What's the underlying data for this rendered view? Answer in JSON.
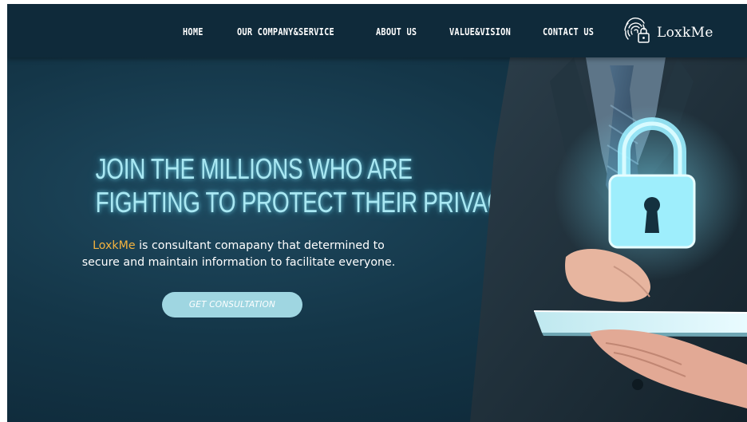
{
  "nav": {
    "items": [
      {
        "label": "HOME"
      },
      {
        "label": "OUR COMPANY&SERVICE"
      },
      {
        "label": "ABOUT US"
      },
      {
        "label": "VALUE&VISION"
      },
      {
        "label": "CONTACT US"
      }
    ],
    "logo_text": "LoxkMe"
  },
  "hero": {
    "title_line1": "JOIN THE MILLIONS WHO ARE",
    "title_line2": "FIGHTING TO PROTECT THEIR PRIVACY.",
    "brand": "LoxkMe",
    "desc_rest": " is consultant comapany that determined to",
    "desc_line2": "secure and maintain information to facilitate everyone.",
    "cta_label": "GET CONSULTATION"
  },
  "colors": {
    "nav_bg": "#0f2a3a",
    "brand_accent": "#f3b23e",
    "cta_bg": "#9fd6e1",
    "title_glow": "#a9e8f3"
  },
  "icons": [
    "fingerprint-lock-icon",
    "padlock-icon"
  ]
}
